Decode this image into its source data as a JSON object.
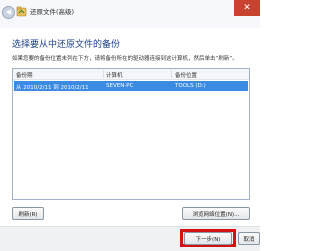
{
  "window": {
    "title": "还原文件(高级)",
    "close_glyph": "✕",
    "back_glyph": "◀",
    "icon": "restore-files-icon"
  },
  "main": {
    "heading": "选择要从中还原文件的备份",
    "description": "如果您要的备份位置未列在下方，请将备份所在的驱动器连接到这计算机，然后单击“刷新”。"
  },
  "table": {
    "columns": [
      "备份期",
      "计算机",
      "备份位置"
    ],
    "rows": [
      {
        "period": "从 2010/2/11 到 2010/2/11",
        "computer": "SEVEN-PC",
        "location": "TOOLS (D:)",
        "selected": true
      }
    ]
  },
  "buttons": {
    "refresh": "刷新(R)",
    "browse_network": "浏览网络位置(N)...",
    "next": "下一步(N)",
    "cancel": "取消"
  },
  "colors": {
    "heading": "#1a3f8a",
    "selection": "#3c8be3",
    "highlight_box": "#d41010"
  }
}
